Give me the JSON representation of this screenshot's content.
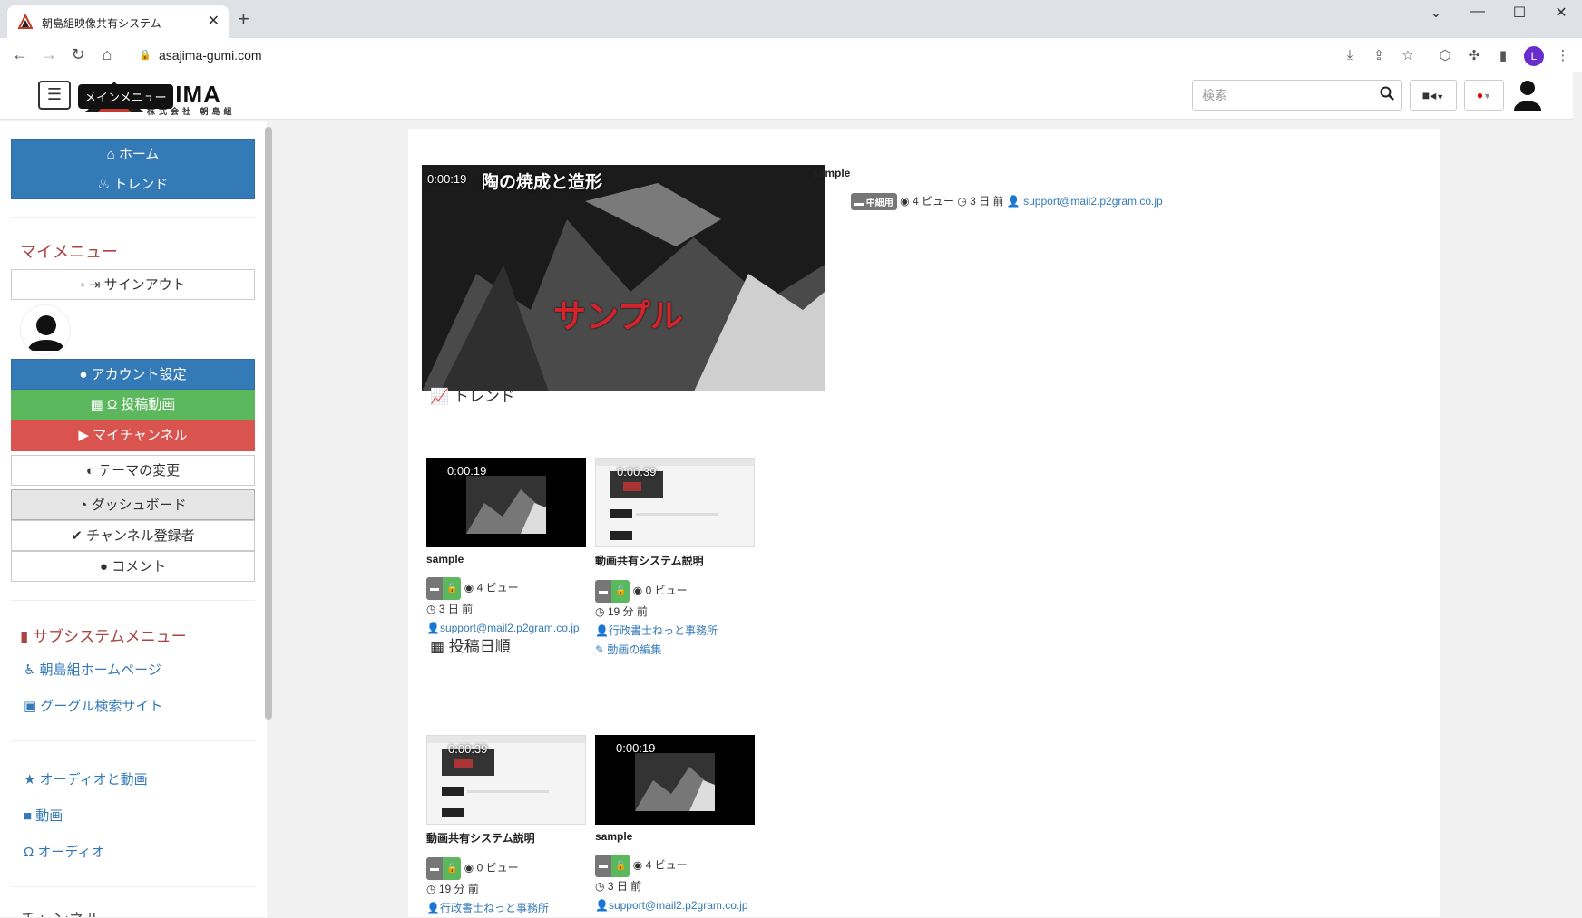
{
  "browser": {
    "tab_title": "朝島組映像共有システム",
    "url": "asajima-gumi.com",
    "profile_initial": "L"
  },
  "header": {
    "logo_text": "AJIMA",
    "logo_sub": "株式会社 朝島組",
    "menu_tooltip": "メインメニュー",
    "search_placeholder": "検索"
  },
  "sidebar": {
    "home": "ホーム",
    "trend": "トレンド",
    "my_menu_title": "マイメニュー",
    "signout": "サインアウト",
    "account_settings": "アカウント設定",
    "posted_videos": "投稿動画",
    "my_channel": "マイチャンネル",
    "theme_change": "テーマの変更",
    "dashboard": "ダッシュボード",
    "channel_subs": "チャンネル登録者",
    "comments": "コメント",
    "subsystem_title": "サブシステムメニュー",
    "asajima_home": "朝島組ホームページ",
    "google_search": "グーグル検索サイト",
    "audio_video": "オーディオと動画",
    "video": "動画",
    "audio": "オーディオ",
    "channel_title": "チャンネル"
  },
  "hero": {
    "duration": "0:00:19",
    "overlay_title": "陶の焼成と造形",
    "overlay_sample": "サンプル",
    "title": "sample",
    "badge": "中細用",
    "views": "4 ビュー",
    "ago": "3 日 前",
    "user": "support@mail2.p2gram.co.jp"
  },
  "trend": {
    "title": "トレンド",
    "cards": [
      {
        "duration": "0:00:19",
        "title": "sample",
        "views": "4 ビュー",
        "ago": "3 日 前",
        "user": "support@mail2.p2gram.co.jp"
      },
      {
        "duration": "0:00:39",
        "title": "動画共有システム説明",
        "views": "0 ビュー",
        "ago": "19 分 前",
        "user": "行政書士ねっと事務所",
        "edit": "動画の編集"
      }
    ]
  },
  "recent": {
    "title": "投稿日順",
    "cards": [
      {
        "duration": "0:00:39",
        "title": "動画共有システム説明",
        "views": "0 ビュー",
        "ago": "19 分 前",
        "user": "行政書士ねっと事務所"
      },
      {
        "duration": "0:00:19",
        "title": "sample",
        "views": "4 ビュー",
        "ago": "3 日 前",
        "user": "support@mail2.p2gram.co.jp"
      }
    ]
  },
  "colors": {
    "primary": "#337ab7",
    "success": "#5cb85c",
    "danger": "#d9534f",
    "section_red": "#a94442"
  }
}
